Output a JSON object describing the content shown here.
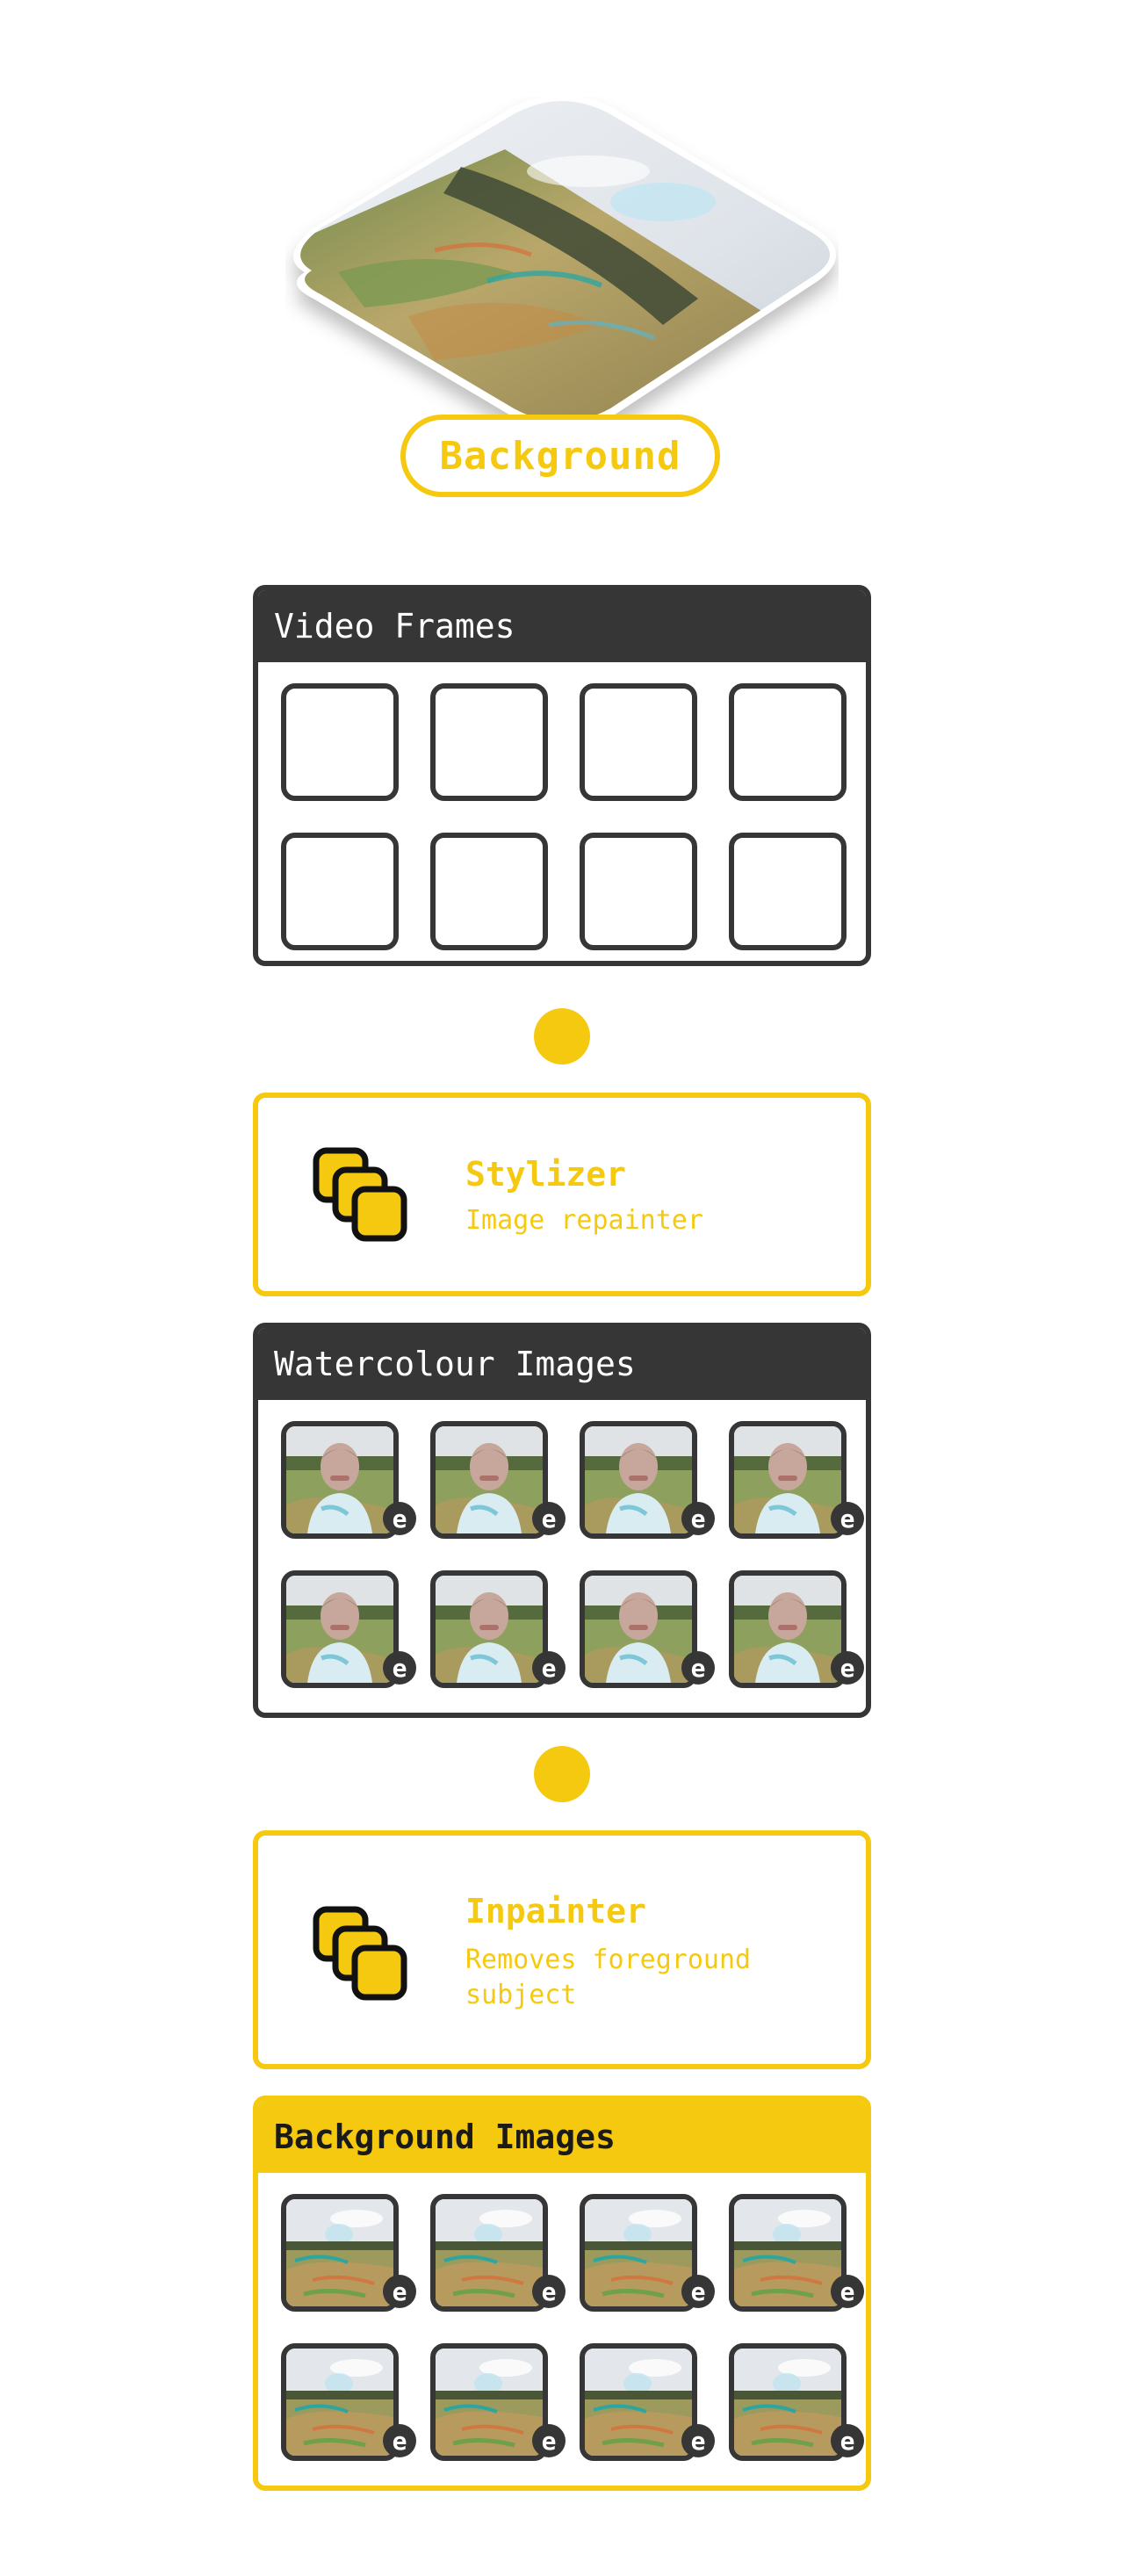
{
  "background_tile": {
    "label": "Background"
  },
  "panels": {
    "video_frames": {
      "title": "Video Frames"
    },
    "watercolour_images": {
      "title": "Watercolour Images",
      "badge": "e"
    },
    "background_images": {
      "title": "Background Images",
      "badge": "e"
    }
  },
  "processes": {
    "stylizer": {
      "title": "Stylizer",
      "description": "Image repainter",
      "icon": "stacked-squares-icon"
    },
    "inpainter": {
      "title": "Inpainter",
      "description": "Removes foreground subject",
      "icon": "stacked-squares-icon"
    }
  },
  "colors": {
    "accent": "#f5c90f",
    "dark": "#363636",
    "background": "#ffffff"
  }
}
